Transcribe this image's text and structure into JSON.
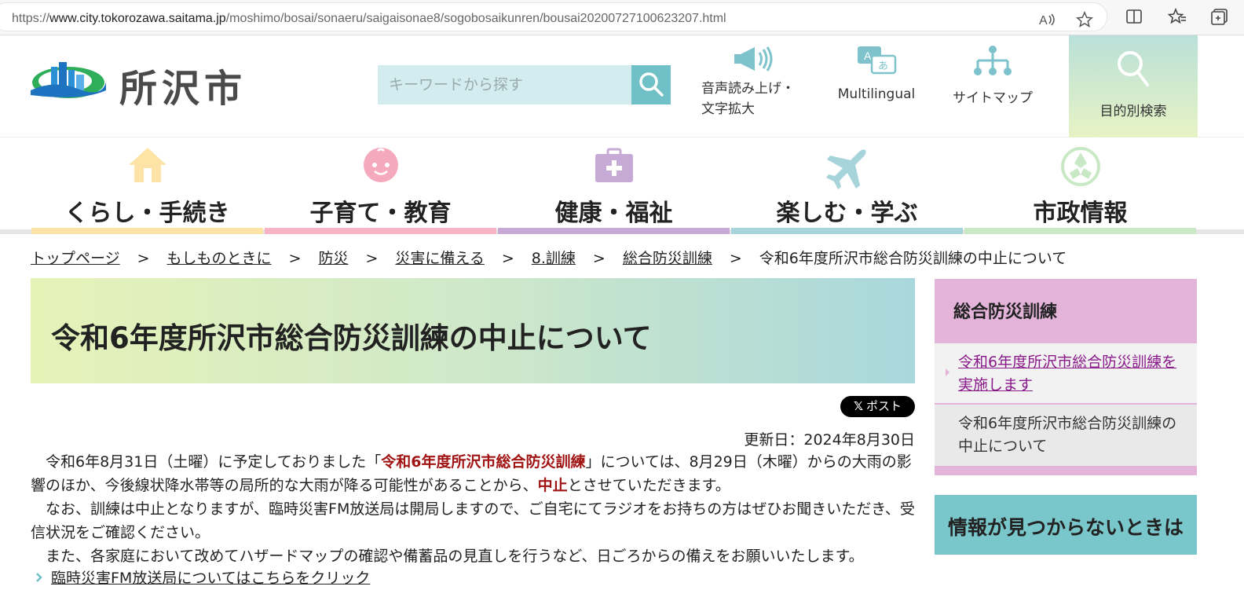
{
  "browser": {
    "url_prefix": "https://",
    "url_host": "www.city.tokorozawa.saitama.jp",
    "url_path": "/moshimo/bosai/sonaeru/saigaisonae8/sogobosaikunren/bousai20200727100623207.html"
  },
  "header": {
    "logo_text": "所沢市",
    "search_placeholder": "キーワードから探す",
    "tools": [
      {
        "label_line1": "音声読み上げ・",
        "label_line2": "文字拡大",
        "icon": "megaphone-icon"
      },
      {
        "label_line1": "Multilingual",
        "icon": "translate-icon"
      },
      {
        "label_line1": "サイトマップ",
        "icon": "sitemap-icon"
      }
    ],
    "purpose_search": "目的別検索"
  },
  "nav": [
    {
      "label": "くらし・手続き",
      "icon": "house-icon",
      "color": "#fde3a6"
    },
    {
      "label": "子育て・教育",
      "icon": "baby-face-icon",
      "color": "#f5b3c3"
    },
    {
      "label": "健康・福祉",
      "icon": "medical-kit-icon",
      "color": "#c7a9d6"
    },
    {
      "label": "楽しむ・学ぶ",
      "icon": "airplane-icon",
      "color": "#a7d3da"
    },
    {
      "label": "市政情報",
      "icon": "city-emblem-icon",
      "color": "#c9e8c5"
    }
  ],
  "breadcrumb": [
    {
      "label": "トップページ",
      "link": true
    },
    {
      "label": "もしものときに",
      "link": true
    },
    {
      "label": "防災",
      "link": true
    },
    {
      "label": "災害に備える",
      "link": true
    },
    {
      "label": "8.訓練",
      "link": true
    },
    {
      "label": "総合防災訓練",
      "link": true
    },
    {
      "label": "令和6年度所沢市総合防災訓練の中止について",
      "link": false
    }
  ],
  "breadcrumb_sep": ">",
  "page": {
    "title": "令和6年度所沢市総合防災訓練の中止について",
    "share_label": "ポスト",
    "updated": "更新日：2024年8月30日",
    "p1_a": "令和6年8月31日（土曜）に予定しておりました「",
    "p1_em": "令和6年度所沢市総合防災訓練",
    "p1_b": "」については、8月29日（木曜）からの大雨の影響のほか、今後線状降水帯等の局所的な大雨が降る可能性があることから、",
    "p1_em2": "中止",
    "p1_c": "とさせていただきます。",
    "p2": "なお、訓練は中止となりますが、臨時災害FM放送局は開局しますので、ご自宅にてラジオをお持ちの方はぜひお聞きいただき、受信状況をご確認ください。",
    "p3": "また、各家庭において改めてハザードマップの確認や備蓄品の見直しを行うなど、日ごろからの備えをお願いいたします。",
    "link": "臨時災害FM放送局についてはこちらをクリック"
  },
  "sidebar": {
    "heading": "総合防災訓練",
    "items": [
      {
        "label": "令和6年度所沢市総合防災訓練を実施します",
        "link": true
      },
      {
        "label": "令和6年度所沢市総合防災訓練の中止について",
        "link": false
      }
    ],
    "notfound": "情報が見つからないときは"
  }
}
